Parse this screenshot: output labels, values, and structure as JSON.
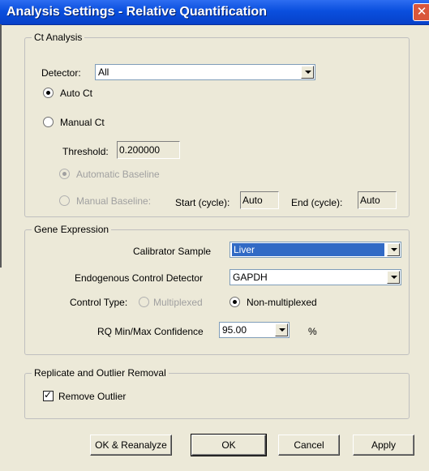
{
  "window": {
    "title": "Analysis Settings - Relative Quantification",
    "close_glyph": "✕"
  },
  "ct_analysis": {
    "legend": "Ct Analysis",
    "detector_label": "Detector:",
    "detector_value": "All",
    "auto_ct_label": "Auto Ct",
    "auto_ct_selected": true,
    "manual_ct_label": "Manual Ct",
    "threshold_label": "Threshold:",
    "threshold_value": "0.200000",
    "automatic_baseline_label": "Automatic Baseline",
    "manual_baseline_label": "Manual Baseline:",
    "start_cycle_label": "Start (cycle):",
    "start_cycle_value": "Auto",
    "end_cycle_label": "End (cycle):",
    "end_cycle_value": "Auto"
  },
  "gene_expression": {
    "legend": "Gene Expression",
    "calibrator_label": "Calibrator Sample",
    "calibrator_value": "Liver",
    "endogenous_label": "Endogenous Control Detector",
    "endogenous_value": "GAPDH",
    "control_type_label": "Control Type:",
    "multiplexed_label": "Multiplexed",
    "non_multiplexed_label": "Non-multiplexed",
    "non_multiplexed_selected": true,
    "rq_label": "RQ Min/Max Confidence",
    "rq_value": "95.00",
    "rq_unit": "%"
  },
  "replicate": {
    "legend": "Replicate and Outlier Removal",
    "remove_outlier_label": "Remove Outlier",
    "remove_outlier_checked": true
  },
  "buttons": {
    "ok_reanalyze": "OK & Reanalyze",
    "ok": "OK",
    "cancel": "Cancel",
    "apply": "Apply"
  },
  "colors": {
    "title_bar": "#0a4fde",
    "dialog_bg": "#ece9d8",
    "selection": "#316ac5"
  },
  "icons": {
    "close": "close-icon",
    "dropdown": "chevron-down-icon",
    "check": "checkmark-icon"
  }
}
